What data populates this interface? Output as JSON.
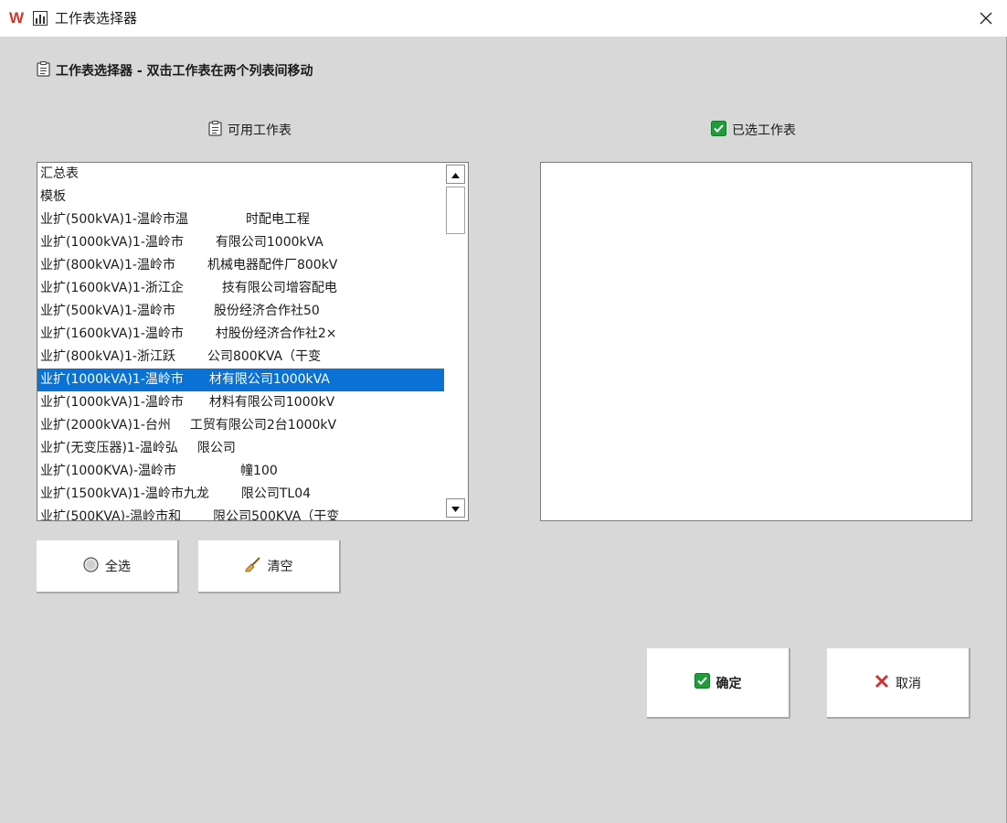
{
  "window": {
    "title": "工作表选择器",
    "app_logo_text": "W"
  },
  "header": {
    "text": "工作表选择器 - 双击工作表在两个列表间移动"
  },
  "available": {
    "label": "可用工作表",
    "items": [
      "汇总表",
      "模板",
      "业扩(500kVA)1-温岭市温         时配电工程",
      "业扩(1000kVA)1-温岭市     有限公司1000kVA",
      "业扩(800kVA)1-温岭市     机械电器配件厂800kV",
      "业扩(1600kVA)1-浙江企      技有限公司增容配电",
      "业扩(500kVA)1-温岭市      股份经济合作社50",
      "业扩(1600kVA)1-温岭市     村股份经济合作社2×",
      "业扩(800kVA)1-浙江跃     公司800KVA（干变",
      "业扩(1000kVA)1-温岭市    材有限公司1000kVA",
      "业扩(1000kVA)1-温岭市    材料有限公司1000kV",
      "业扩(2000kVA)1-台州   工贸有限公司2台1000kV",
      "业扩(无变压器)1-温岭弘   限公司",
      "业扩(1000KVA)-温岭市          幢100",
      "业扩(1500kVA)1-温岭市九龙     限公司TL04",
      "业扩(500KVA)-温岭市和     限公司500KVA（干变"
    ],
    "selected_index": 9
  },
  "selected": {
    "label": "已选工作表",
    "items": []
  },
  "buttons": {
    "select_all": "全选",
    "clear": "清空",
    "ok": "确定",
    "cancel": "取消"
  },
  "colors": {
    "highlight": "#0a72d6",
    "ok_green": "#1f9d3a",
    "cancel_red": "#d33131",
    "brand_red": "#d9342b"
  },
  "icons": {
    "app": "wps-logo-icon",
    "title": "bar-chart-icon",
    "header": "clipboard-icon",
    "available": "clipboard-icon",
    "selected": "green-check-icon",
    "select_all": "radio-circle-icon",
    "clear": "broom-icon",
    "ok": "green-check-icon",
    "cancel": "red-x-icon",
    "close": "close-icon"
  }
}
